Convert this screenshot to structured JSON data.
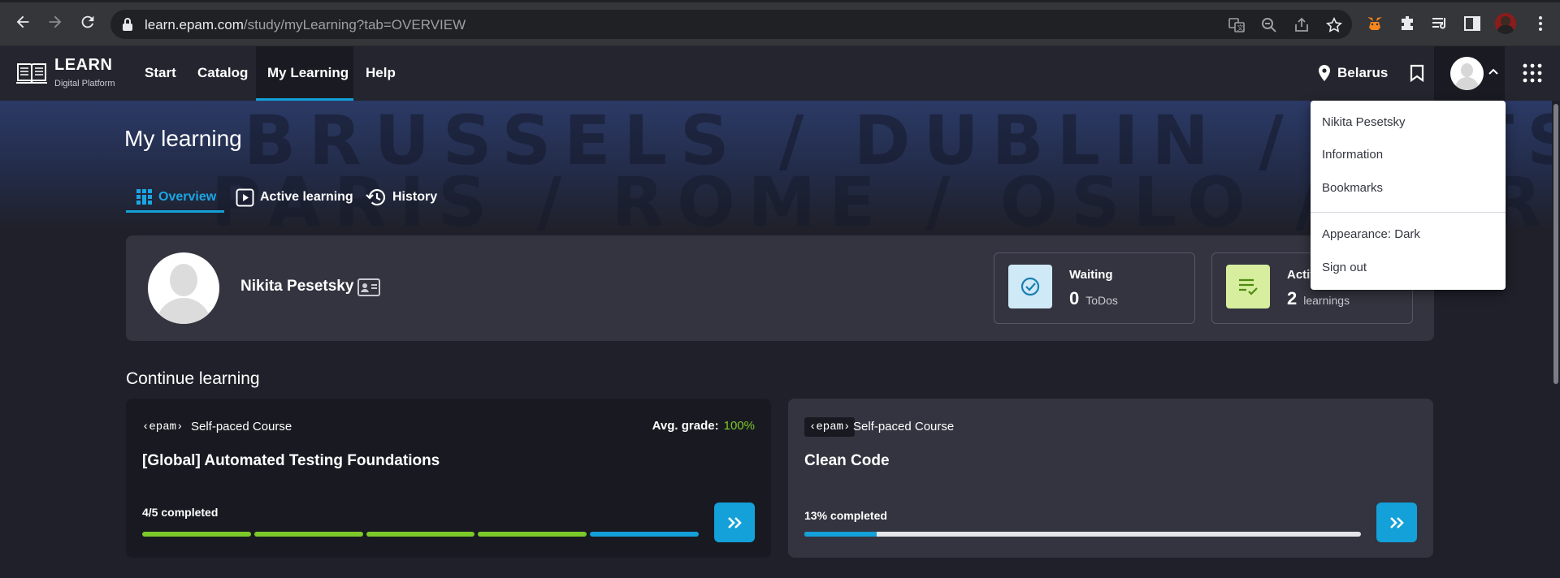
{
  "browser": {
    "url_host": "learn.epam.com",
    "url_path": "/study/myLearning?tab=OVERVIEW"
  },
  "header": {
    "logo_title": "LEARN",
    "logo_subtitle": "Digital Platform",
    "nav": [
      "Start",
      "Catalog",
      "My Learning",
      "Help"
    ],
    "active_nav": "My Learning",
    "location": "Belarus"
  },
  "hero": {
    "watermark_line1": "BRUSSELS / DUBLIN / POTSDAM /",
    "watermark_line2": "PARIS / ROME / OSLO / FERR"
  },
  "page": {
    "title": "My learning",
    "tabs": [
      "Overview",
      "Active learning",
      "History"
    ],
    "active_tab": "Overview"
  },
  "profile": {
    "name": "Nikita Pesetsky",
    "stats": [
      {
        "label": "Waiting",
        "value": "0",
        "unit": "ToDos",
        "icon": "check-circle-icon",
        "color": "#cfe9f6"
      },
      {
        "label": "Active",
        "value": "2",
        "unit": "learnings",
        "icon": "list-check-icon",
        "color": "#d6ee9e"
      }
    ]
  },
  "continue": {
    "title": "Continue learning",
    "courses": [
      {
        "provider": "‹epam›",
        "type": "Self-paced Course",
        "avg_label": "Avg. grade:",
        "avg_value": "100%",
        "title": "[Global] Automated Testing Foundations",
        "progress_label": "4/5 completed",
        "segments": [
          "done",
          "done",
          "done",
          "done",
          "current"
        ]
      },
      {
        "provider": "‹epam›",
        "type": "Self-paced Course",
        "title": "Clean Code",
        "progress_label": "13% completed",
        "progress": 0.13
      }
    ]
  },
  "dropdown": {
    "items": [
      "Nikita Pesetsky",
      "Information",
      "Bookmarks",
      "Appearance: Dark",
      "Sign out"
    ]
  },
  "colors": {
    "accent": "#14a0d8",
    "green": "#7cc92a"
  }
}
